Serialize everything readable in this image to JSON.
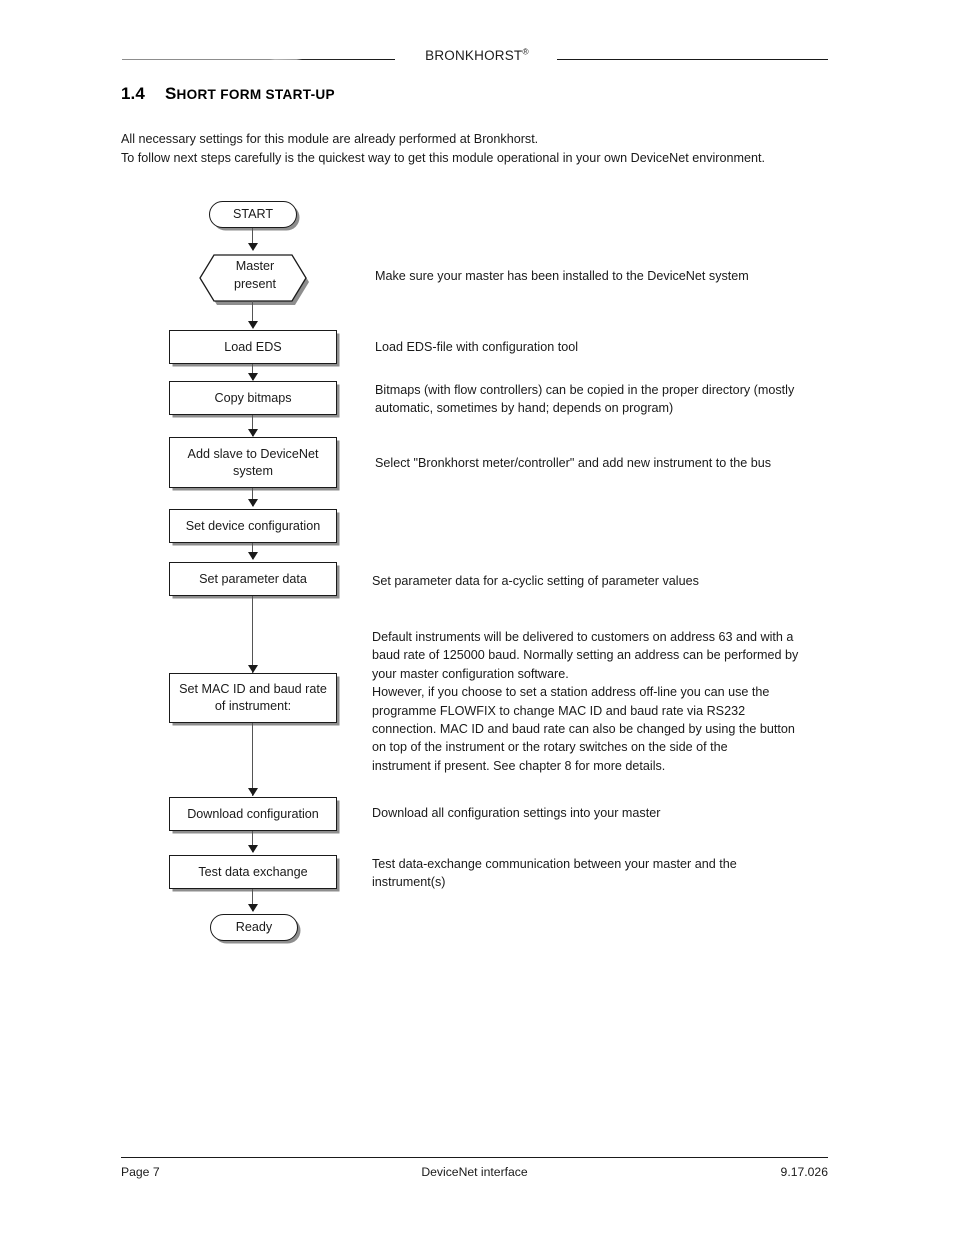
{
  "header": {
    "brand": "BRONKHORST",
    "brand_mark": "®"
  },
  "section": {
    "number": "1.4",
    "title_first_letter": "S",
    "title_rest": "HORT FORM START-UP",
    "title_full": "1.4 Short form start-up"
  },
  "intro": {
    "line1": "All necessary settings for this module are already performed at Bronkhorst.",
    "line2": "To follow next steps carefully is the quickest way to get this module operational in your own DeviceNet environment."
  },
  "flowchart": {
    "nodes": [
      {
        "id": "start",
        "shape": "terminator",
        "label": "START"
      },
      {
        "id": "master",
        "shape": "hexagon",
        "label_line1": "Master",
        "label_line2": "present"
      },
      {
        "id": "load_eds",
        "shape": "process",
        "label": "Load EDS"
      },
      {
        "id": "bitmaps",
        "shape": "process",
        "label": "Copy bitmaps"
      },
      {
        "id": "add_slave",
        "shape": "process",
        "label": "Add slave to DeviceNet system"
      },
      {
        "id": "device_cfg",
        "shape": "process",
        "label": "Set device configuration"
      },
      {
        "id": "param",
        "shape": "process",
        "label": "Set parameter data"
      },
      {
        "id": "macid",
        "shape": "process",
        "label": "Set MAC ID and baud rate of instrument:"
      },
      {
        "id": "download",
        "shape": "process",
        "label": "Download configuration"
      },
      {
        "id": "test",
        "shape": "process",
        "label": "Test data exchange"
      },
      {
        "id": "ready",
        "shape": "terminator",
        "label": "Ready"
      }
    ]
  },
  "annotations": {
    "master": "Make sure your master has been installed to the DeviceNet system",
    "load_eds": "Load EDS-file with configuration tool",
    "bitmaps_line1": "Bitmaps (with flow controllers) can be copied in the proper directory (mostly",
    "bitmaps_line2": "automatic, sometimes by hand; depends on program)",
    "add_slave": "Select \"Bronkhorst meter/controller\" and add new instrument to the bus",
    "param": "Set parameter data for a-cyclic setting of parameter values",
    "macid_line1": "Default instruments will be delivered to customers on address 63 and with a",
    "macid_line2": "baud rate of 125000 baud. Normally setting an address can be performed by",
    "macid_line3": "your master configuration software.",
    "macid_line4": "However, if you choose to set a station address off-line you can use the",
    "macid_line5": "programme FLOWFIX to change MAC ID and baud rate via RS232",
    "macid_line6": "connection. MAC ID and baud rate can also be changed by using the button",
    "macid_line7": "on top of the instrument or the rotary switches on the side of the",
    "macid_line8": "instrument if present. See chapter 8 for more details.",
    "download": "Download all configuration settings into your master",
    "test_line1": "Test data-exchange communication between your master and the",
    "test_line2": "instrument(s)"
  },
  "footer": {
    "page": "Page 7",
    "doc_title": "DeviceNet interface",
    "doc_number": "9.17.026"
  }
}
